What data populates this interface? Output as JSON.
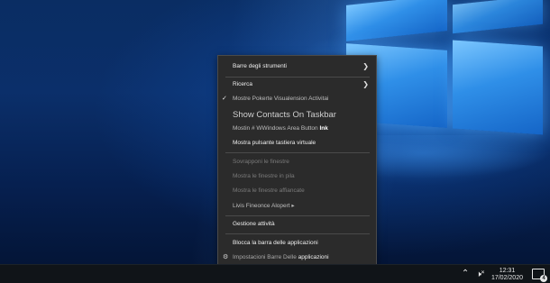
{
  "menu": {
    "toolbars": "Barre degli strumenti",
    "search": "Ricerca",
    "show_task_view": "Mostre Pokerte Visualension Activitai",
    "show_contacts": "Show Contacts On Taskbar",
    "windows_ink": "Mostin # WWindows Area Button",
    "windows_ink_tag": "Ink",
    "touch_keyboard": "Mostra pulsante tastiera virtuale",
    "cascade": "Sovrapponi le finestre",
    "stacked": "Mostra le finestre in pila",
    "side_by_side": "Mostra le finestre affiancate",
    "show_desktop": "Livis Fineonce Alopert ▸",
    "task_manager": "Gestione attività",
    "lock_taskbar": "Blocca la barra delle applicazioni",
    "settings": "Impostacioni Barre Delle",
    "settings_tail": "applicazioni"
  },
  "taskbar": {
    "time": "12:31",
    "date": "17/02/2020",
    "notification_count": "4"
  },
  "icons": {
    "submenu": "chevron-right-icon",
    "check": "check-icon",
    "settings": "gear-icon",
    "tray_up": "chevron-up-icon",
    "volume": "volume-mute-icon",
    "notifications": "notification-icon"
  }
}
